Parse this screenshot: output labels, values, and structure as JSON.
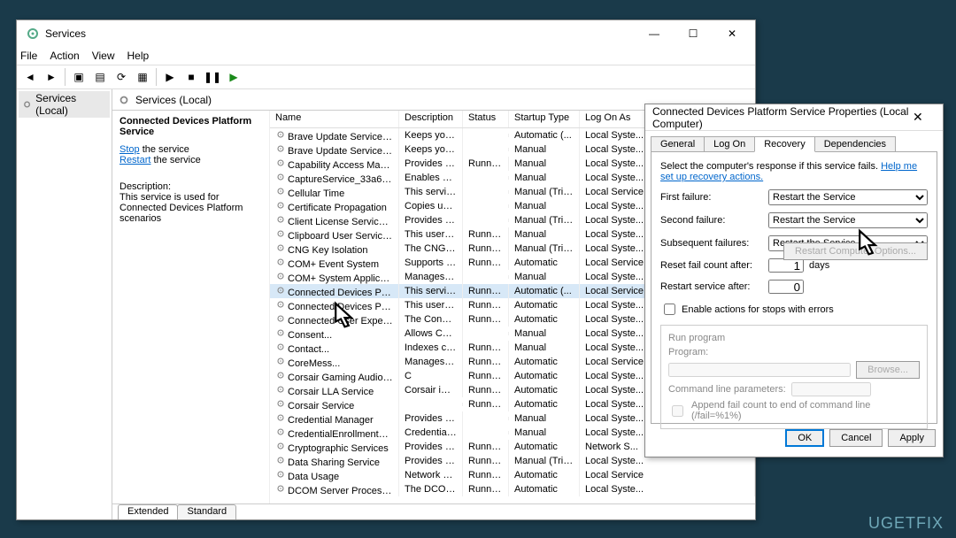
{
  "main": {
    "title": "Services"
  },
  "menu": {
    "file": "File",
    "action": "Action",
    "view": "View",
    "help": "Help"
  },
  "tree": {
    "root": "Services (Local)"
  },
  "header": {
    "title": "Services (Local)"
  },
  "detail": {
    "name": "Connected Devices Platform Service",
    "stop": "Stop",
    "stop_tail": " the service",
    "restart": "Restart",
    "restart_tail": " the service",
    "desc_label": "Description:",
    "desc": "This service is used for Connected Devices Platform scenarios"
  },
  "cols": {
    "name": "Name",
    "desc": "Description",
    "status": "Status",
    "startup": "Startup Type",
    "logon": "Log On As"
  },
  "services": [
    {
      "n": "Brave Update Service (brave)",
      "d": "Keeps your ...",
      "s": "",
      "t": "Automatic (...",
      "l": "Local Syste..."
    },
    {
      "n": "Brave Update Service (brave...",
      "d": "Keeps your ...",
      "s": "",
      "t": "Manual",
      "l": "Local Syste..."
    },
    {
      "n": "Capability Access Manager ...",
      "d": "Provides fac...",
      "s": "Running",
      "t": "Manual",
      "l": "Local Syste..."
    },
    {
      "n": "CaptureService_33a6c70f",
      "d": "Enables opti...",
      "s": "",
      "t": "Manual",
      "l": "Local Syste..."
    },
    {
      "n": "Cellular Time",
      "d": "This service ...",
      "s": "",
      "t": "Manual (Trig...",
      "l": "Local Service"
    },
    {
      "n": "Certificate Propagation",
      "d": "Copies user ...",
      "s": "",
      "t": "Manual",
      "l": "Local Syste..."
    },
    {
      "n": "Client License Service (ClipS...",
      "d": "Provides inf...",
      "s": "",
      "t": "Manual (Trig...",
      "l": "Local Syste..."
    },
    {
      "n": "Clipboard User Service_33a6...",
      "d": "This user ser...",
      "s": "Running",
      "t": "Manual",
      "l": "Local Syste..."
    },
    {
      "n": "CNG Key Isolation",
      "d": "The CNG ke...",
      "s": "Running",
      "t": "Manual (Trig...",
      "l": "Local Syste..."
    },
    {
      "n": "COM+ Event System",
      "d": "Supports Sy...",
      "s": "Running",
      "t": "Automatic",
      "l": "Local Service"
    },
    {
      "n": "COM+ System Application",
      "d": "Manages th...",
      "s": "",
      "t": "Manual",
      "l": "Local Syste..."
    },
    {
      "n": "Connected Devices Platfor...",
      "d": "This service ...",
      "s": "Running",
      "t": "Automatic (...",
      "l": "Local Service",
      "sel": true
    },
    {
      "n": "Connected Devices Platfor...",
      "d": "This user ser...",
      "s": "Running",
      "t": "Automatic",
      "l": "Local Syste..."
    },
    {
      "n": "Connected User Experience...",
      "d": "The Connec...",
      "s": "Running",
      "t": "Automatic",
      "l": "Local Syste..."
    },
    {
      "n": "Consent...",
      "d": "Allows Con...",
      "s": "",
      "t": "Manual",
      "l": "Local Syste..."
    },
    {
      "n": "Contact...",
      "d": "Indexes con...",
      "s": "Running",
      "t": "Manual",
      "l": "Local Syste..."
    },
    {
      "n": "CoreMess...",
      "d": "Manages co...",
      "s": "Running",
      "t": "Automatic",
      "l": "Local Service"
    },
    {
      "n": "Corsair Gaming Audio Conf...",
      "d": "C",
      "s": "Running",
      "t": "Automatic",
      "l": "Local Syste..."
    },
    {
      "n": "Corsair LLA Service",
      "d": "Corsair iCU...",
      "s": "Running",
      "t": "Automatic",
      "l": "Local Syste..."
    },
    {
      "n": "Corsair Service",
      "d": "",
      "s": "Running",
      "t": "Automatic",
      "l": "Local Syste..."
    },
    {
      "n": "Credential Manager",
      "d": "Provides se...",
      "s": "",
      "t": "Manual",
      "l": "Local Syste..."
    },
    {
      "n": "CredentialEnrollmentMana...",
      "d": "Credential E...",
      "s": "",
      "t": "Manual",
      "l": "Local Syste..."
    },
    {
      "n": "Cryptographic Services",
      "d": "Provides thr...",
      "s": "Running",
      "t": "Automatic",
      "l": "Network S..."
    },
    {
      "n": "Data Sharing Service",
      "d": "Provides da...",
      "s": "Running",
      "t": "Manual (Trig...",
      "l": "Local Syste..."
    },
    {
      "n": "Data Usage",
      "d": "Network da...",
      "s": "Running",
      "t": "Automatic",
      "l": "Local Service"
    },
    {
      "n": "DCOM Server Process Laun...",
      "d": "The DCOML...",
      "s": "Running",
      "t": "Automatic",
      "l": "Local Syste..."
    }
  ],
  "bottom_tabs": {
    "ext": "Extended",
    "std": "Standard"
  },
  "props": {
    "title": "Connected Devices Platform Service Properties (Local Computer)",
    "tabs": {
      "general": "General",
      "logon": "Log On",
      "recovery": "Recovery",
      "deps": "Dependencies"
    },
    "hint1": "Select the computer's response if this service fails.",
    "hint_link": "Help me set up recovery actions.",
    "first": "First failure:",
    "second": "Second failure:",
    "subseq": "Subsequent failures:",
    "action": "Restart the Service",
    "reset": "Reset fail count after:",
    "reset_val": "1",
    "reset_unit": "days",
    "restart": "Restart service after:",
    "restart_val": "0",
    "enable_chk": "Enable actions for stops with errors",
    "rcopt": "Restart Computer Options...",
    "group": "Run program",
    "program": "Program:",
    "browse": "Browse...",
    "cmdline": "Command line parameters:",
    "append": "Append fail count to end of command line (/fail=%1%)",
    "ok": "OK",
    "cancel": "Cancel",
    "apply": "Apply"
  },
  "watermark": "UGETFIX"
}
